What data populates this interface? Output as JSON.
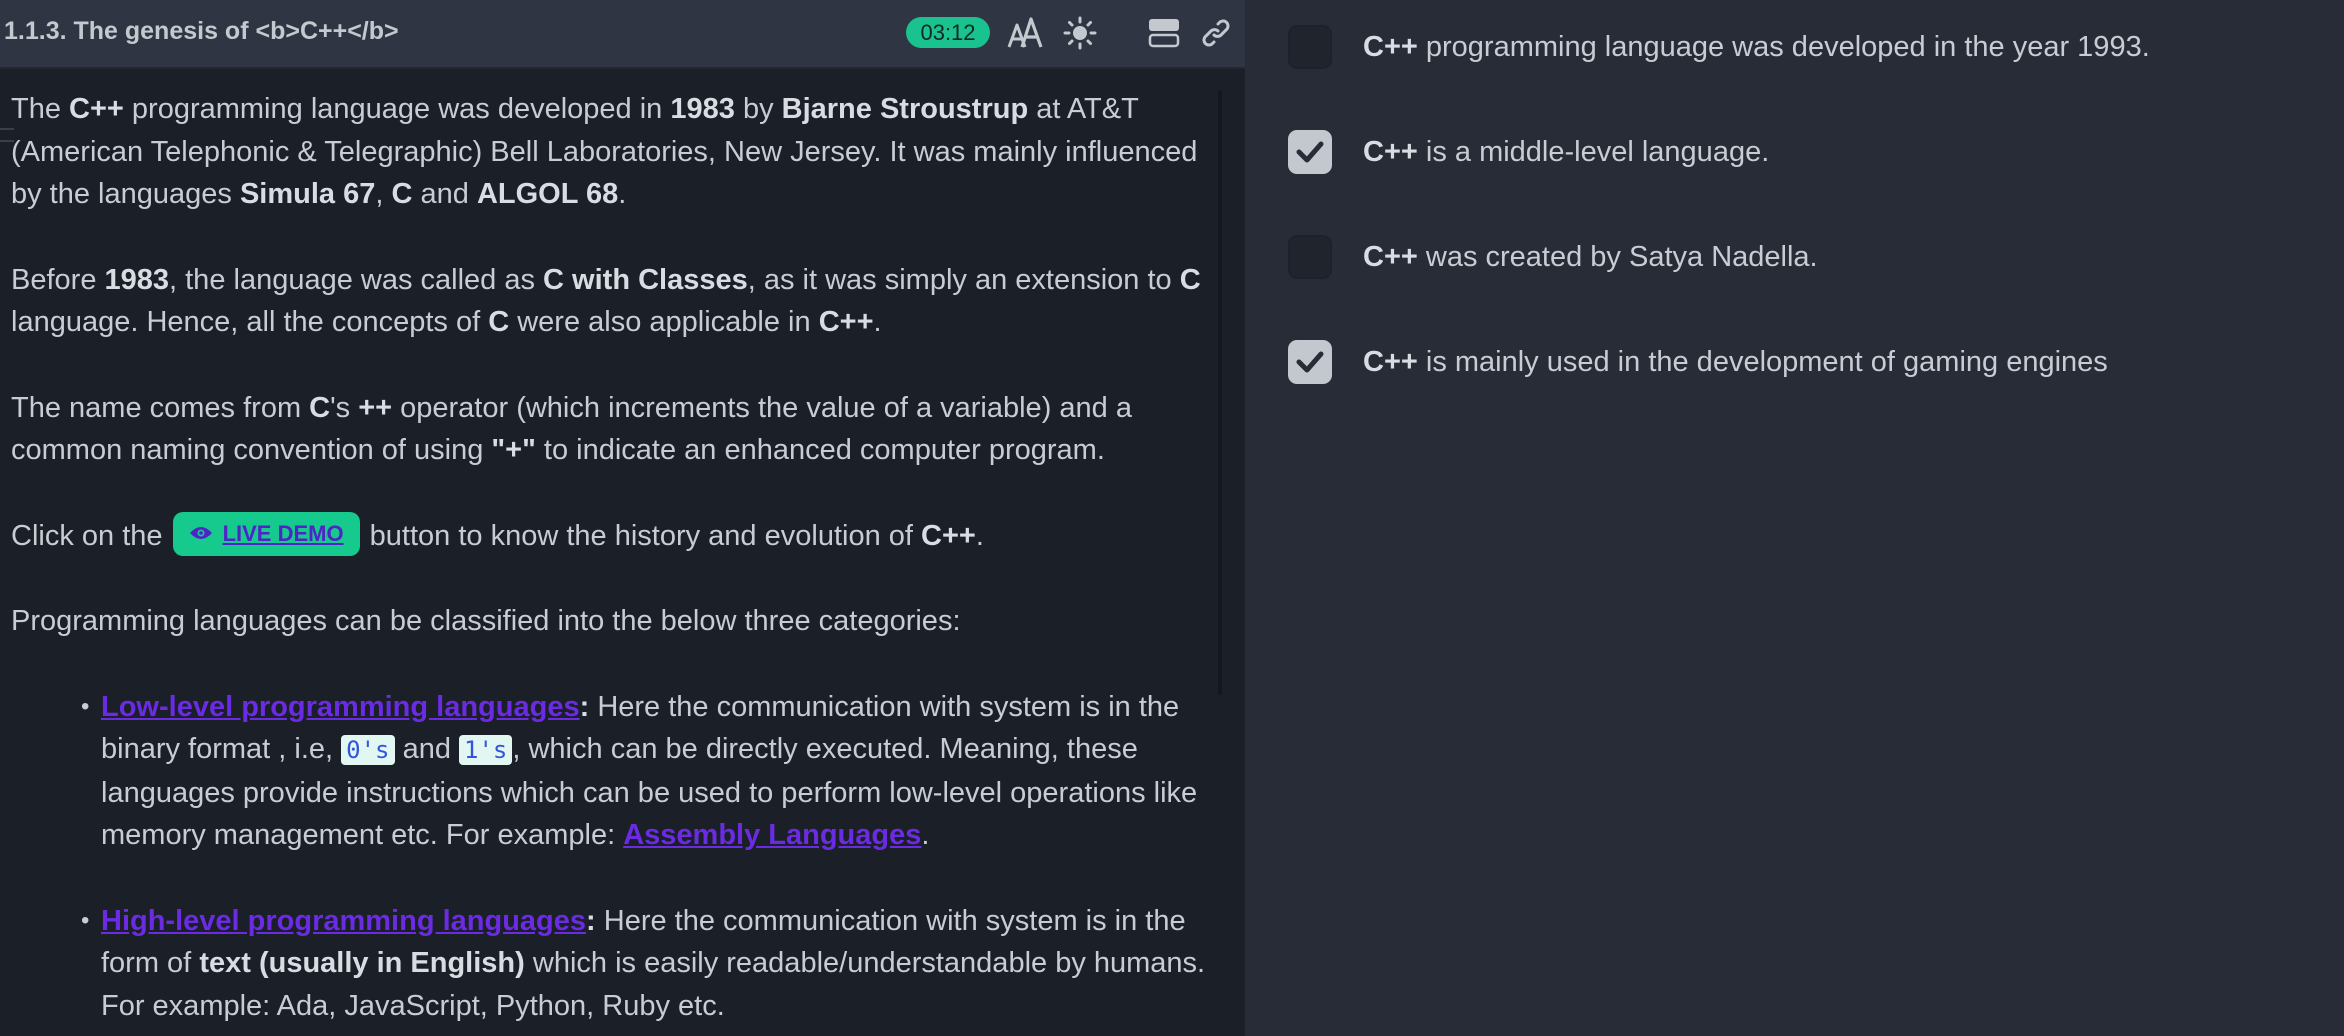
{
  "header": {
    "title": "1.1.3. The genesis of <b>C++</b>",
    "timer": "03:12"
  },
  "icons": {
    "font_size": "font-size-icon",
    "theme": "sun-icon",
    "layout": "layout-split-icon",
    "link": "link-icon",
    "live_demo": "eye-icon"
  },
  "colors": {
    "accent": "#19c28e",
    "link": "#6a2be3"
  },
  "content": {
    "p1": {
      "t1": "The ",
      "b1": "C++",
      "t2": " programming language was developed in ",
      "b2": "1983",
      "t3": " by ",
      "b3": "Bjarne Stroustrup",
      "t4": " at AT&T (American Telephonic & Telegraphic) Bell Laboratories, New Jersey. It was mainly influenced by the languages ",
      "b4": "Simula 67",
      "t5": ", ",
      "b5": "C",
      "t6": " and ",
      "b6": "ALGOL 68",
      "t7": "."
    },
    "p2": {
      "t1": "Before ",
      "b1": "1983",
      "t2": ", the language was called as ",
      "b2": "C with Classes",
      "t3": ", as it was simply an extension to ",
      "b3": "C",
      "t4": " language. Hence, all the concepts of ",
      "b4": "C",
      "t5": " were also applicable in ",
      "b5": "C++",
      "t6": "."
    },
    "p3": {
      "t1": "The name comes from ",
      "b1": "C",
      "t2": "'s ",
      "b2": "++",
      "t3": " operator (which increments the value of a variable) and a common naming convention of using ",
      "b3": "\"+\"",
      "t4": " to indicate an enhanced computer program."
    },
    "p4": {
      "t1": "Click on the ",
      "button": "LIVE DEMO",
      "t2": " button to know the history and evolution of ",
      "b1": "C++",
      "t3": "."
    },
    "p5": "Programming languages can be classified into the below three categories:",
    "list": {
      "low": {
        "link": "Low-level programming languages",
        "colon": ":",
        "t1": " Here the communication with system is in the binary format , i.e, ",
        "code1": "0's",
        "t2": " and ",
        "code2": "1's",
        "t3": ", which can be directly executed. Meaning, these languages provide instructions which can be used to perform low-level operations like memory management etc. For example: ",
        "link2": "Assembly Languages",
        "t4": "."
      },
      "high": {
        "link": "High-level programming languages",
        "colon": ":",
        "t1": " Here the communication with system is in the form of ",
        "b1": "text (usually in English)",
        "t2": " which is easily readable/understandable by humans. For example: Ada, JavaScript, Python, Ruby etc."
      }
    }
  },
  "options": [
    {
      "bold": "C++",
      "text": " programming language was developed in the year 1993.",
      "checked": false
    },
    {
      "bold": "C++",
      "text": " is a middle-level language.",
      "checked": true
    },
    {
      "bold": "C++",
      "text": " was created by Satya Nadella.",
      "checked": false
    },
    {
      "bold": "C++",
      "text": " is mainly used in the development of gaming engines",
      "checked": true
    }
  ]
}
